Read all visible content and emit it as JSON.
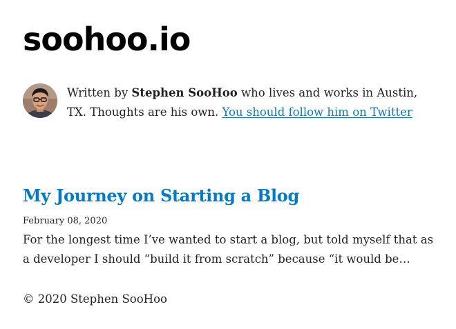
{
  "site": {
    "title": "soohoo.io"
  },
  "bio": {
    "prefix": "Written by ",
    "author": "Stephen SooHoo",
    "suffix": " who lives and works in Austin, TX. Thoughts are his own. ",
    "link_text": "You should follow him on Twitter",
    "avatar_icon": "avatar-photo-icon"
  },
  "posts": [
    {
      "title": "My Journey on Starting a Blog",
      "date": "February 08, 2020",
      "excerpt": "For the longest time I’ve wanted to start a blog, but told myself that as a developer I should “build it from scratch” because “it would be…"
    }
  ],
  "footer": {
    "text": "© 2020 Stephen SooHoo"
  },
  "colors": {
    "link": "#007acc",
    "text": "#222222",
    "title": "#000000"
  }
}
